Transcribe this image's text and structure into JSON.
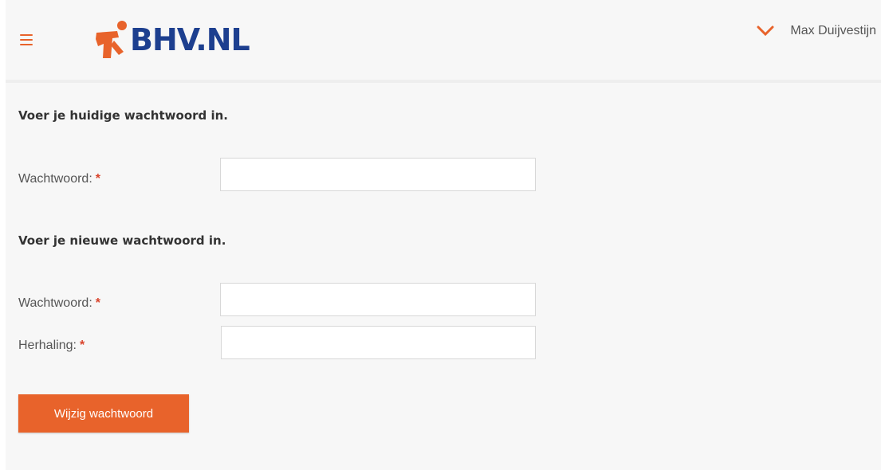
{
  "header": {
    "logo_text": "BHV.NL",
    "user_name": "Max Duijvestijn",
    "menu_icon": "hamburger-menu-icon",
    "dropdown_icon": "chevron-down-icon"
  },
  "form": {
    "current_section_title": "Voer je huidige wachtwoord in.",
    "new_section_title": "Voer je nieuwe wachtwoord in.",
    "current_password_label": "Wachtwoord:",
    "new_password_label": "Wachtwoord:",
    "repeat_password_label": "Herhaling:",
    "required_marker": "*",
    "current_password_value": "",
    "new_password_value": "",
    "repeat_password_value": "",
    "submit_label": "Wijzig wachtwoord"
  },
  "colors": {
    "accent": "#e8632b",
    "logo_blue": "#1d3f8f",
    "background": "#f7f7f7",
    "required": "#d9442c"
  }
}
